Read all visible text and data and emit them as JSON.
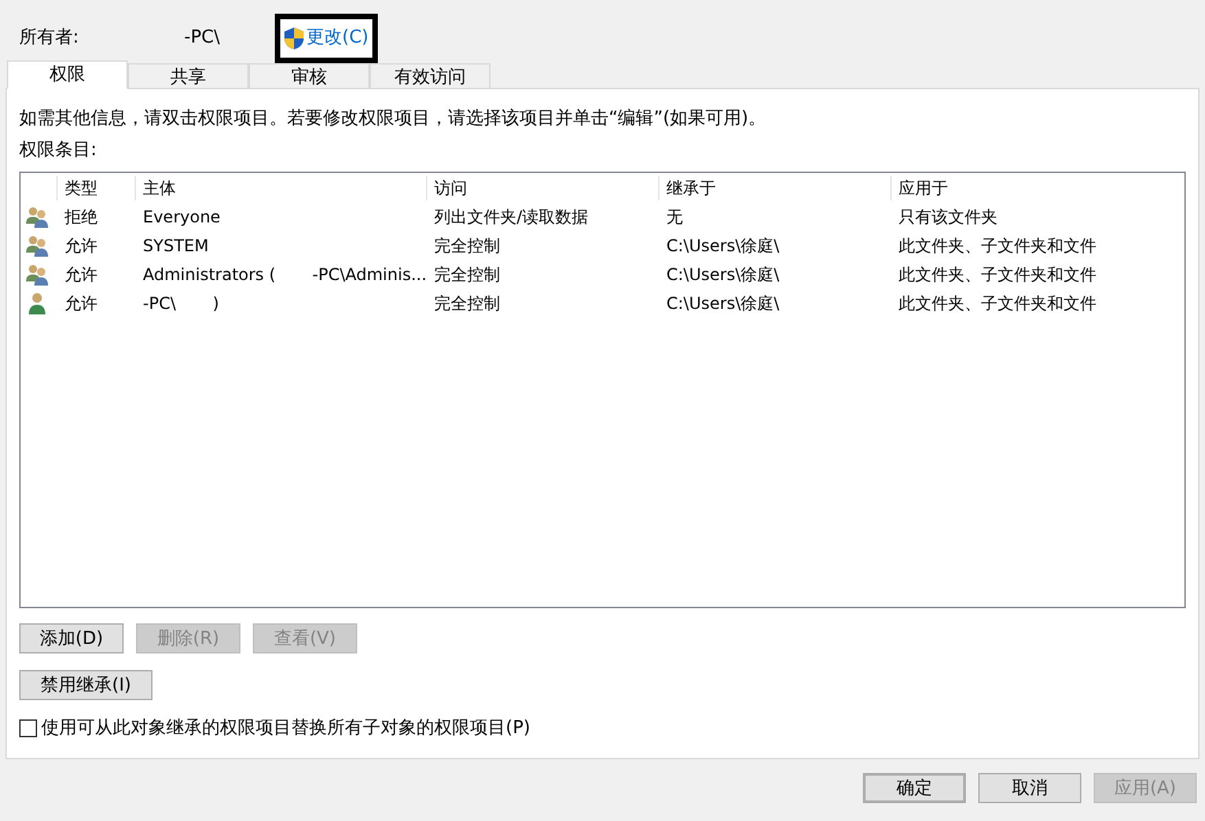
{
  "owner": {
    "label": "所有者:",
    "value": "-PC\\",
    "change_link": {
      "label": "更改(C)",
      "highlighted": true
    }
  },
  "tabs": [
    {
      "label": "权限",
      "selected": true
    },
    {
      "label": "共享",
      "selected": false
    },
    {
      "label": "审核",
      "selected": false
    },
    {
      "label": "有效访问",
      "selected": false
    }
  ],
  "info_text": "如需其他信息，请双击权限项目。若要修改权限项目，请选择该项目并单击“编辑”(如果可用)。",
  "entries_label": "权限条目:",
  "table": {
    "columns": [
      "类型",
      "主体",
      "访问",
      "继承于",
      "应用于"
    ],
    "rows": [
      {
        "kind": "group",
        "cells": [
          "拒绝",
          "Everyone",
          "列出文件夹/读取数据",
          "无",
          "只有该文件夹"
        ]
      },
      {
        "kind": "group",
        "cells": [
          "允许",
          "SYSTEM",
          "完全控制",
          "C:\\Users\\徐庭\\",
          "此文件夹、子文件夹和文件"
        ]
      },
      {
        "kind": "group",
        "cells": [
          "允许",
          "Administrators (       -PC\\Adminis...",
          "完全控制",
          "C:\\Users\\徐庭\\",
          "此文件夹、子文件夹和文件"
        ]
      },
      {
        "kind": "user",
        "cells": [
          "允许",
          "-PC\\       )",
          "完全控制",
          "C:\\Users\\徐庭\\",
          "此文件夹、子文件夹和文件"
        ]
      }
    ]
  },
  "row_buttons": [
    {
      "label": "添加(D)",
      "disabled": false
    },
    {
      "label": "删除(R)",
      "disabled": true
    },
    {
      "label": "查看(V)",
      "disabled": true
    }
  ],
  "inherit_button": {
    "label": "禁用继承(I)",
    "disabled": false
  },
  "replace_checkbox": {
    "label": "使用可从此对象继承的权限项目替换所有子对象的权限项目(P)",
    "checked": false
  },
  "dialog_buttons": [
    {
      "label": "确定",
      "disabled": false,
      "default": true
    },
    {
      "label": "取消",
      "disabled": false,
      "default": false
    },
    {
      "label": "应用(A)",
      "disabled": true,
      "default": false
    }
  ]
}
